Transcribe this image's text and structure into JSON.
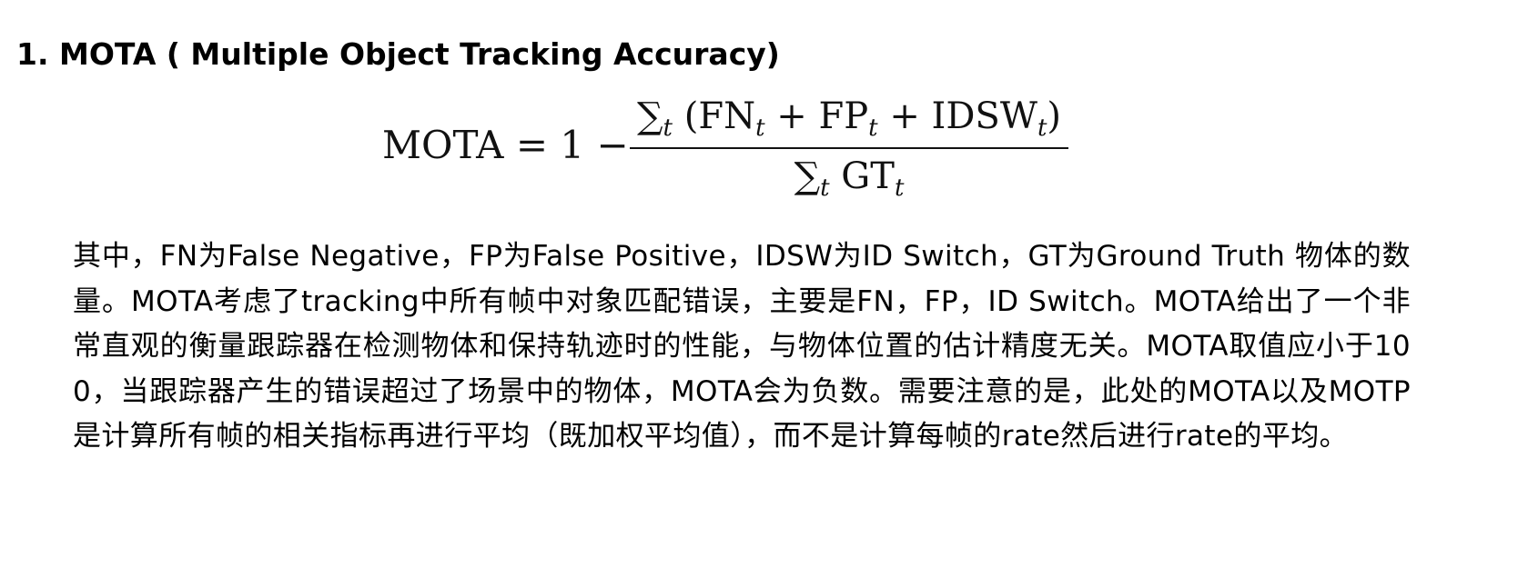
{
  "heading": "1. MOTA ( Multiple Object Tracking Accuracy)",
  "formula": {
    "lhs": "MOTA = 1 −",
    "numerator": {
      "sum": "∑",
      "sum_sub": "t",
      "open": " (FN",
      "fn_sub": "t",
      "plus1": " + FP",
      "fp_sub": "t",
      "plus2": " + IDSW",
      "idsw_sub": "t",
      "close": ")"
    },
    "denominator": {
      "sum": "∑",
      "sum_sub": "t",
      "gt": " GT",
      "gt_sub": "t"
    }
  },
  "paragraph": "其中，FN为False Negative，FP为False Positive，IDSW为ID Switch，GT为Ground Truth 物体的数量。MOTA考虑了tracking中所有帧中对象匹配错误，主要是FN，FP，ID Switch。MOTA给出了一个非常直观的衡量跟踪器在检测物体和保持轨迹时的性能，与物体位置的估计精度无关。MOTA取值应小于100，当跟踪器产生的错误超过了场景中的物体，MOTA会为负数。需要注意的是，此处的MOTA以及MOTP是计算所有帧的相关指标再进行平均（既加权平均值），而不是计算每帧的rate然后进行rate的平均。"
}
